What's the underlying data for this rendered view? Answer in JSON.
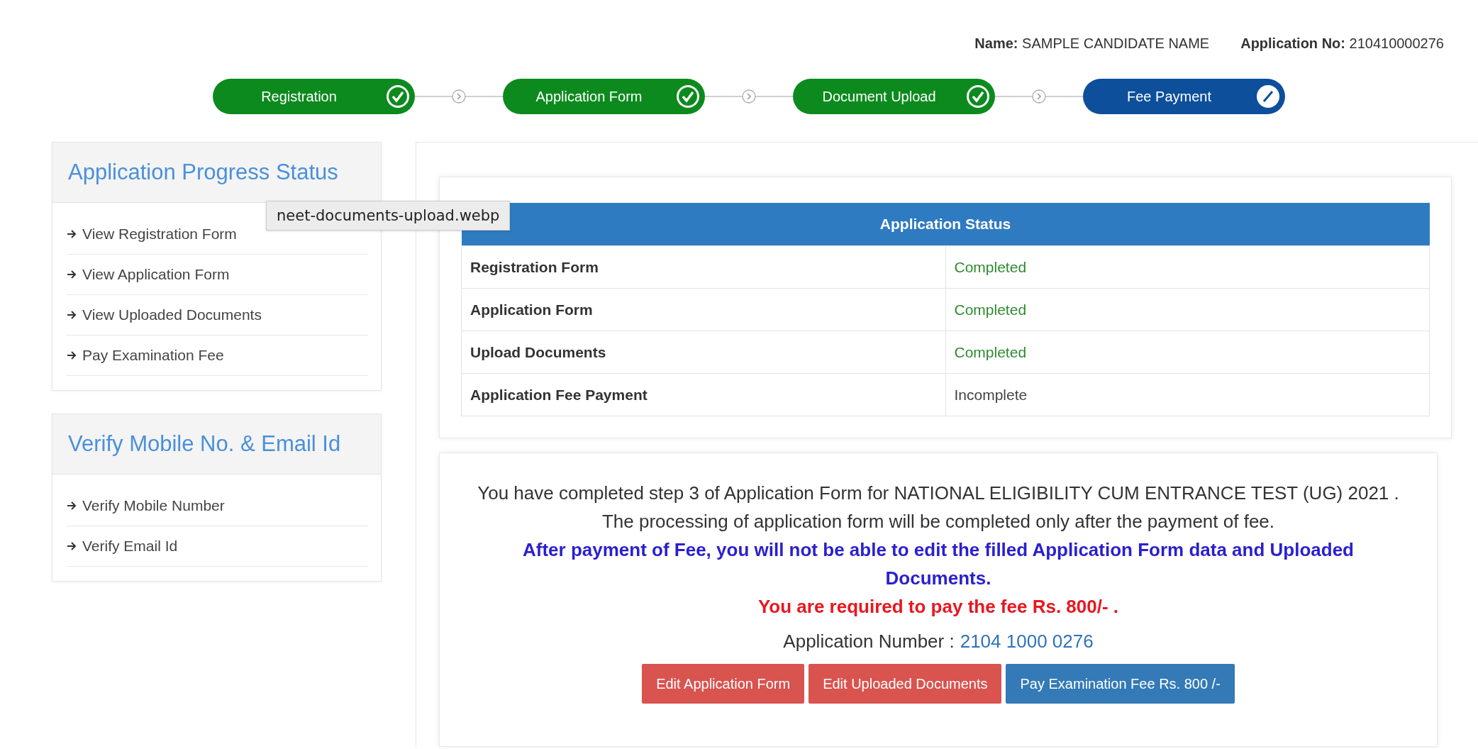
{
  "header": {
    "name_label": "Name:",
    "name_value": "SAMPLE CANDIDATE NAME",
    "appno_label": "Application No:",
    "appno_value": "210410000276"
  },
  "steps": [
    {
      "label": "Registration",
      "completed": true
    },
    {
      "label": "Application Form",
      "completed": true
    },
    {
      "label": "Document Upload",
      "completed": true
    },
    {
      "label": "Fee Payment",
      "completed": false
    }
  ],
  "sidebar": [
    {
      "title": "Application Progress Status",
      "items": [
        "View Registration Form",
        "View Application Form",
        "View Uploaded Documents",
        "Pay Examination Fee"
      ]
    },
    {
      "title": "Verify Mobile No. & Email Id",
      "items": [
        "Verify Mobile Number",
        "Verify Email Id"
      ]
    }
  ],
  "tooltip": "neet-documents-upload.webp",
  "status_table": {
    "title": "Application Status",
    "rows": [
      {
        "item": "Registration Form",
        "status": "Completed",
        "completed": true
      },
      {
        "item": "Application Form",
        "status": "Completed",
        "completed": true
      },
      {
        "item": "Upload Documents",
        "status": "Completed",
        "completed": true
      },
      {
        "item": "Application Fee Payment",
        "status": "Incomplete",
        "completed": false
      }
    ]
  },
  "message": {
    "lines": [
      {
        "kind": "plain",
        "text": "You have completed step 3 of Application Form for NATIONAL ELIGIBILITY CUM ENTRANCE TEST (UG) 2021 ."
      },
      {
        "kind": "plain",
        "text": "The processing of application form will be completed only after the payment of fee."
      },
      {
        "kind": "notice",
        "text": "After payment of Fee, you will not be able to edit the filled Application Form data and Uploaded Documents."
      },
      {
        "kind": "warning",
        "text": "You are required to pay the fee Rs. 800/- ."
      }
    ],
    "appnum_label": "Application Number :",
    "appnum_value": "2104 1000 0276"
  },
  "buttons": [
    {
      "label": "Edit Application Form",
      "kind": "danger"
    },
    {
      "label": "Edit Uploaded Documents",
      "kind": "danger"
    },
    {
      "label": "Pay Examination Fee Rs. 800 /-",
      "kind": "primary"
    }
  ]
}
